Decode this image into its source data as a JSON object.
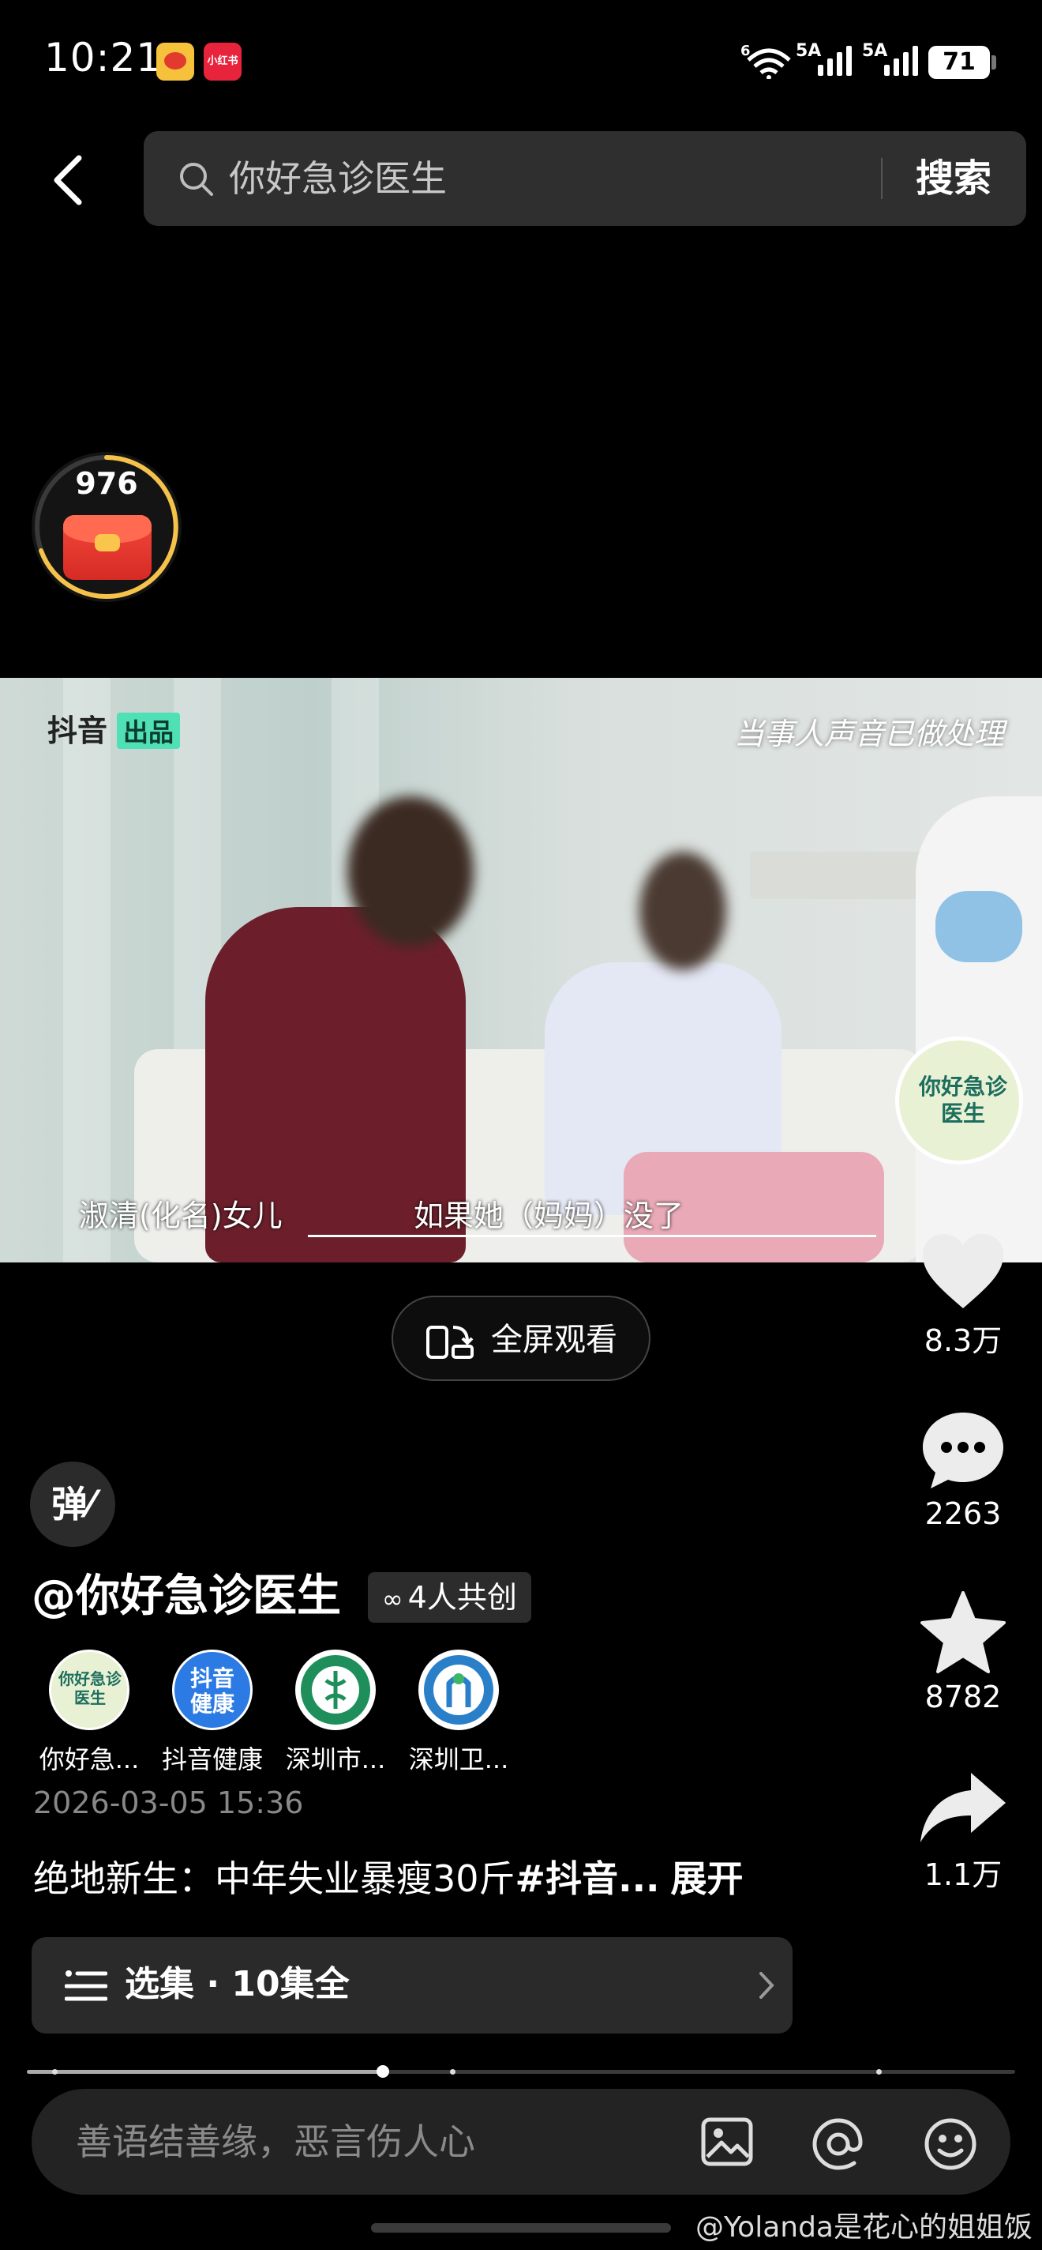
{
  "status_bar": {
    "time": "10:21",
    "app_badges": [
      "weibo-icon",
      "xiaohongshu-icon"
    ],
    "xhs_badge_text": "小红书",
    "signal_labels": [
      "5A",
      "5A"
    ],
    "wifi_label": "6",
    "battery": "71"
  },
  "search": {
    "query": "你好急诊医生",
    "button_label": "搜索"
  },
  "red_packet": {
    "count": "976"
  },
  "video": {
    "watermark": "抖音",
    "watermark_tag": "出品",
    "notice": "当事人声音已做处理",
    "subtitle_speaker": "淑清(化名)女儿",
    "subtitle_text": "如果她（妈妈）没了",
    "series_logo_text": "你好急诊医生"
  },
  "fullscreen": {
    "label": "全屏观看"
  },
  "actions": {
    "likes": "8.3万",
    "comments": "2263",
    "favorites": "8782",
    "shares": "1.1万"
  },
  "danmaku": {
    "label": "弹"
  },
  "author": {
    "name": "@你好急诊医生",
    "co_create": "4人共创"
  },
  "creators": [
    {
      "name": "你好急...",
      "avatar_text": "你好急诊医生",
      "color": "#e9f1d4"
    },
    {
      "name": "抖音健康",
      "avatar_text": "抖音健康",
      "color": "#2c7be5"
    },
    {
      "name": "深圳市...",
      "avatar_text": "",
      "color": "#1e8f5a"
    },
    {
      "name": "深圳卫...",
      "avatar_text": "",
      "color": "#2a7fc9"
    }
  ],
  "post": {
    "date": "2026-03-05 15:36",
    "title": "绝地新生：中年失业暴瘦30斤",
    "title_tag": "#抖音...",
    "expand": "展开"
  },
  "episodes": {
    "label": "选集 · 10集全"
  },
  "progress": {
    "played_fraction": 0.36
  },
  "comment": {
    "placeholder": "善语结善缘，恶言伤人心"
  },
  "source_watermark": "@Yolanda是花心的姐姐饭"
}
